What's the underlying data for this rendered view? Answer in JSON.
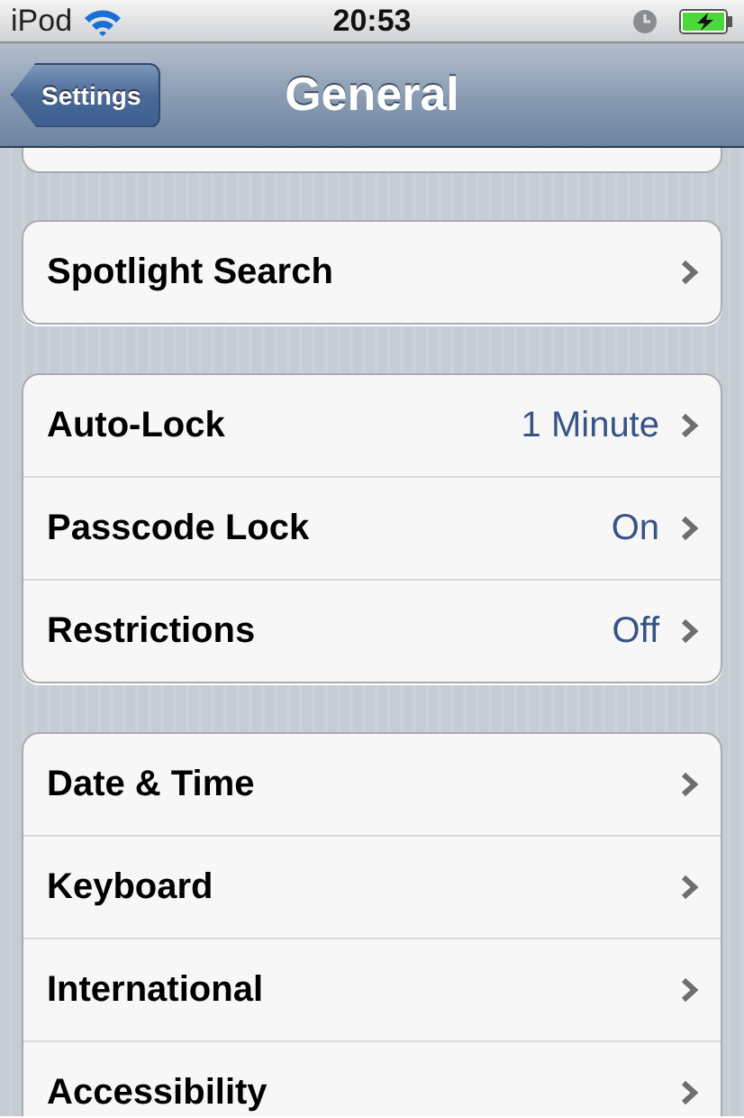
{
  "status_bar": {
    "carrier": "iPod",
    "time": "20:53"
  },
  "nav_bar": {
    "back_button": "Settings",
    "title": "General"
  },
  "groups": [
    {
      "rows": [
        {
          "label": "Spotlight Search"
        }
      ]
    },
    {
      "rows": [
        {
          "label": "Auto-Lock",
          "value": "1 Minute"
        },
        {
          "label": "Passcode Lock",
          "value": "On"
        },
        {
          "label": "Restrictions",
          "value": "Off"
        }
      ]
    },
    {
      "rows": [
        {
          "label": "Date & Time"
        },
        {
          "label": "Keyboard"
        },
        {
          "label": "International"
        },
        {
          "label": "Accessibility"
        }
      ]
    }
  ]
}
